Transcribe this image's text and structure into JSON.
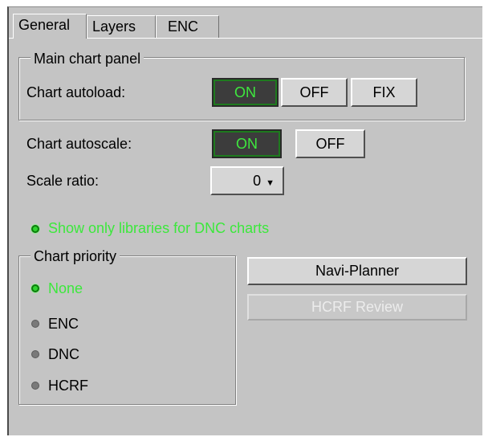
{
  "tabs": [
    "General",
    "Layers",
    "ENC"
  ],
  "main_chart_panel": {
    "legend": "Main chart panel",
    "autoload_label": "Chart autoload:",
    "autoload_buttons": [
      "ON",
      "OFF",
      "FIX"
    ],
    "autoload_selected": "ON"
  },
  "autoscale": {
    "label": "Chart autoscale:",
    "buttons": [
      "ON",
      "OFF"
    ],
    "selected": "ON"
  },
  "scale_ratio": {
    "label": "Scale ratio:",
    "value": "0"
  },
  "dnc_only": {
    "label": "Show only libraries for DNC charts",
    "checked": true
  },
  "chart_priority": {
    "legend": "Chart priority",
    "options": [
      "None",
      "ENC",
      "DNC",
      "HCRF"
    ],
    "selected": "None"
  },
  "actions": {
    "navi_planner": "Navi-Planner",
    "hcrf_review": "HCRF Review"
  },
  "colors": {
    "panel_bg": "#c4c4c4",
    "active_green": "#3ce83c",
    "on_button_bg": "#3c3c3c"
  }
}
